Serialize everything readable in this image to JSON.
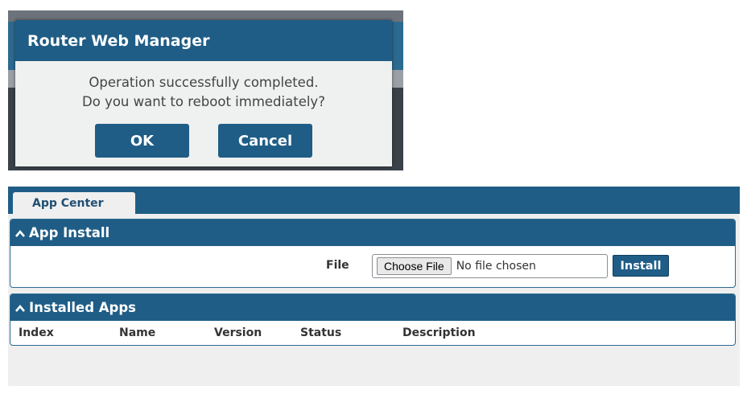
{
  "dialog": {
    "title": "Router Web Manager",
    "message_line1": "Operation successfully completed.",
    "message_line2": "Do you want to reboot immediately?",
    "ok_label": "OK",
    "cancel_label": "Cancel"
  },
  "app_center": {
    "tab_label": "App Center",
    "install_panel": {
      "title": "App Install",
      "file_label": "File",
      "choose_file_label": "Choose File",
      "file_status": "No file chosen",
      "install_label": "Install"
    },
    "installed_panel": {
      "title": "Installed Apps",
      "columns": [
        "Index",
        "Name",
        "Version",
        "Status",
        "Description"
      ]
    }
  },
  "colors": {
    "brand_blue": "#1f5d86",
    "panel_border": "#2c6a91"
  },
  "icons": {
    "panel_toggle": "chevron-up-icon"
  }
}
